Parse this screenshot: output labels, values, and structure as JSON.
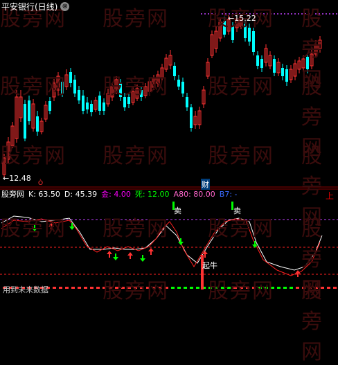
{
  "header": {
    "title": "平安银行(日线)",
    "close_icon": "⊗"
  },
  "watermark_text": "股旁网",
  "main": {
    "high_label": "←15.22",
    "low_label": "←12.48",
    "marker_event": "财",
    "marker_small": "Ò"
  },
  "indicator": {
    "name": "股旁网",
    "k_label": "K:",
    "k_value": "63.50",
    "d_label": "D:",
    "d_value": "45.39",
    "gold_label": "金:",
    "gold_value": "4.00",
    "dead_label": "死:",
    "dead_value": "12.00",
    "a80_label": "A80:",
    "a80_value": "80.00",
    "b7_label": "B7:",
    "b7_value": "-",
    "up_mark": "上",
    "sell_label": "卖",
    "bull_label": "起牛",
    "footer_label": "用到未来数据"
  },
  "colors": {
    "up": "#ff3232",
    "down": "#00ffff",
    "gold": "#ff00ff",
    "dead": "#00ff00",
    "dotted": "#c040ff",
    "kline": "#ffffff",
    "dline": "#ff2020"
  }
}
